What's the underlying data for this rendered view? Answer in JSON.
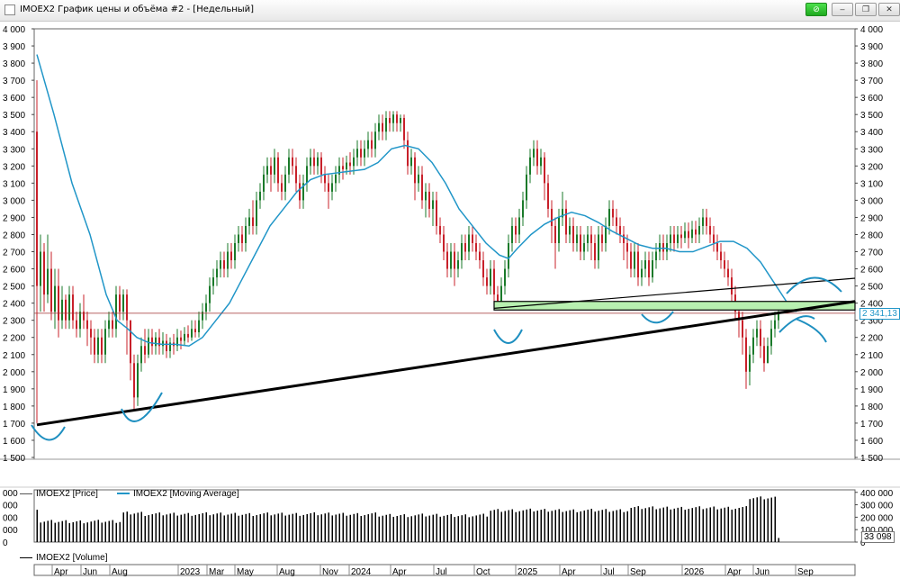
{
  "window": {
    "title": "IMOEX2 График цены и объёма #2 - [Недельный]",
    "buttons": {
      "link": "⊘",
      "minimize": "–",
      "restore": "❐",
      "close": "✕"
    }
  },
  "price_panel": {
    "y_ticks": [
      "1 500",
      "1 600",
      "1 700",
      "1 800",
      "1 900",
      "2 000",
      "2 100",
      "2 200",
      "2 300",
      "2 400",
      "2 500",
      "2 600",
      "2 700",
      "2 800",
      "2 900",
      "3 000",
      "3 100",
      "3 200",
      "3 300",
      "3 400",
      "3 500",
      "3 600",
      "3 700",
      "3 800",
      "3 900",
      "4 000"
    ],
    "current_price_label": "2 341,13",
    "legend": [
      {
        "label": "IMOEX2 [Price]",
        "color": "#555555"
      },
      {
        "label": "IMOEX2 [Moving Average]",
        "color": "#2196c8"
      }
    ]
  },
  "volume_panel": {
    "y_ticks": [
      "0",
      "100 000",
      "200 000",
      "300 000",
      "400 000"
    ],
    "left_ticks": [
      "0",
      "000",
      "000",
      "000",
      "000"
    ],
    "current_volume_label": "33 098",
    "legend": {
      "label": "IMOEX2 [Volume]"
    }
  },
  "time_axis": {
    "labels": [
      "Apr",
      "Jun",
      "Aug",
      "2023",
      "Mar",
      "May",
      "Aug",
      "Nov",
      "2024",
      "Apr",
      "Jul",
      "Oct",
      "2025",
      "Apr",
      "Jul",
      "Sep",
      "2026",
      "Apr",
      "Jun",
      "Sep"
    ]
  },
  "colors": {
    "up_candle": "#1a7a2a",
    "down_candle": "#c8202a",
    "moving_average": "#2196c8",
    "trendline": "#000000",
    "zone_fill": "#b8f0b0",
    "annotation": "#1e8fc0",
    "price_line": "#a03030"
  }
}
